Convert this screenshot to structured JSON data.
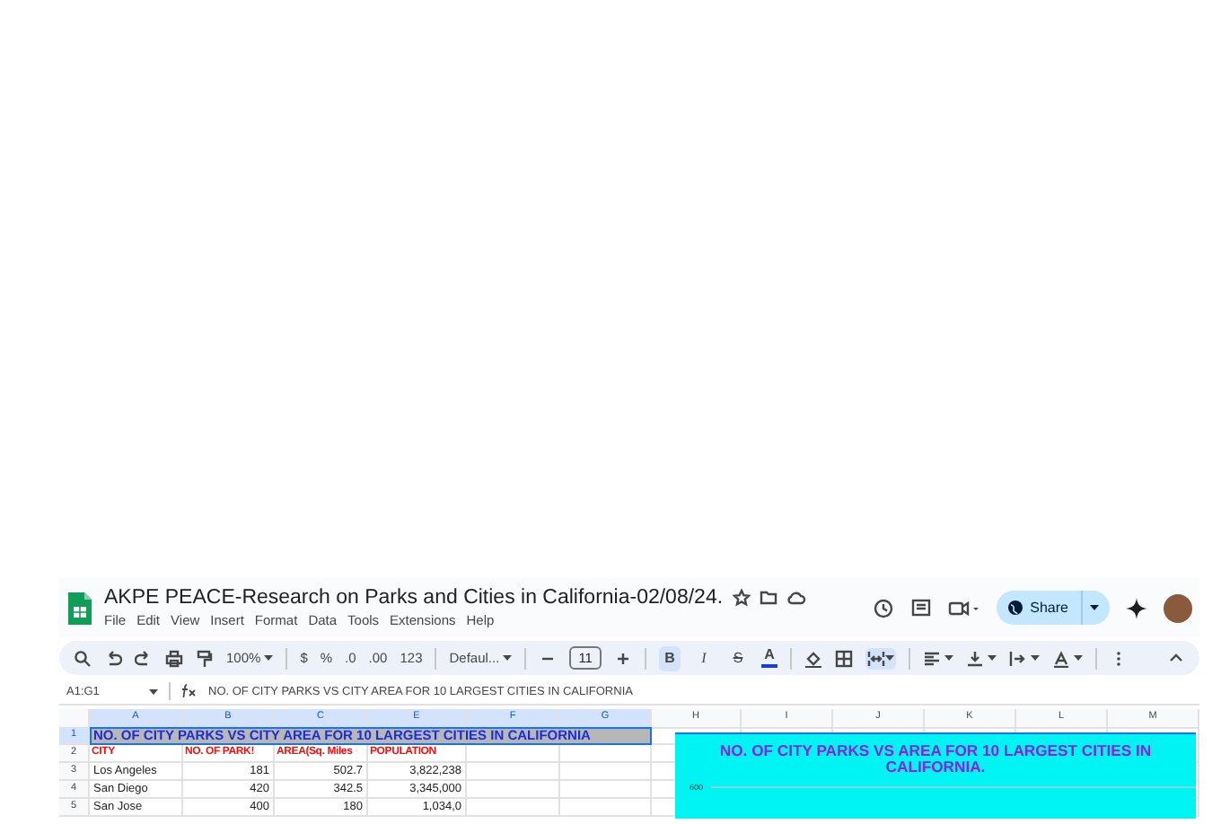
{
  "document": {
    "title": "AKPE PEACE-Research on Parks and Cities in California-02/08/24.",
    "menu": [
      "File",
      "Edit",
      "View",
      "Insert",
      "Format",
      "Data",
      "Tools",
      "Extensions",
      "Help"
    ],
    "share_label": "Share"
  },
  "toolbar": {
    "zoom": "100%",
    "currency": "$",
    "percent": "%",
    "decimal_decrease": ".0",
    "decimal_increase": ".00",
    "number_format": "123",
    "font": "Defaul...",
    "font_size": "11",
    "bold": {
      "label": "B",
      "on": true
    },
    "italic": {
      "label": "I",
      "on": false
    },
    "strikethrough": {
      "label": "S",
      "on": false
    },
    "text_color": {
      "label": "A",
      "color": "#1a3fd6"
    },
    "merge_on": true
  },
  "formula_bar": {
    "cell_range": "A1:G1",
    "content": "NO. OF CITY PARKS VS CITY AREA FOR 10 LARGEST CITIES IN CALIFORNIA"
  },
  "columns": [
    {
      "label": "A",
      "selected": true
    },
    {
      "label": "B",
      "selected": true
    },
    {
      "label": "C",
      "selected": true
    },
    {
      "label": "E",
      "selected": true
    },
    {
      "label": "F",
      "selected": true
    },
    {
      "label": "G",
      "selected": true
    },
    {
      "label": "H",
      "selected": false
    },
    {
      "label": "I",
      "selected": false
    },
    {
      "label": "J",
      "selected": false
    },
    {
      "label": "K",
      "selected": false
    },
    {
      "label": "L",
      "selected": false
    },
    {
      "label": "M",
      "selected": false
    }
  ],
  "rows": [
    {
      "number": "1",
      "selected": true,
      "kind": "title",
      "cells": [
        "NO. OF CITY PARKS VS CITY AREA FOR 10 LARGEST CITIES IN CALIFORNIA"
      ]
    },
    {
      "number": "2",
      "selected": false,
      "kind": "header",
      "cells": [
        "CITY",
        "NO. OF PARK!",
        "AREA(Sq. Miles",
        "POPULATION"
      ]
    },
    {
      "number": "3",
      "selected": false,
      "kind": "data",
      "cells": [
        "Los Angeles",
        "181",
        "502.7",
        "3,822,238"
      ]
    },
    {
      "number": "4",
      "selected": false,
      "kind": "data",
      "cells": [
        "San Diego",
        "420",
        "342.5",
        "3,345,000"
      ]
    },
    {
      "number": "5",
      "selected": false,
      "kind": "data",
      "cells": [
        "San Jose",
        "400",
        "180",
        "1,034,0"
      ]
    }
  ],
  "chart": {
    "title": "NO. OF CITY PARKS VS AREA FOR 10 LARGEST CITIES IN CALIFORNIA.",
    "y_tick_label": "600"
  }
}
